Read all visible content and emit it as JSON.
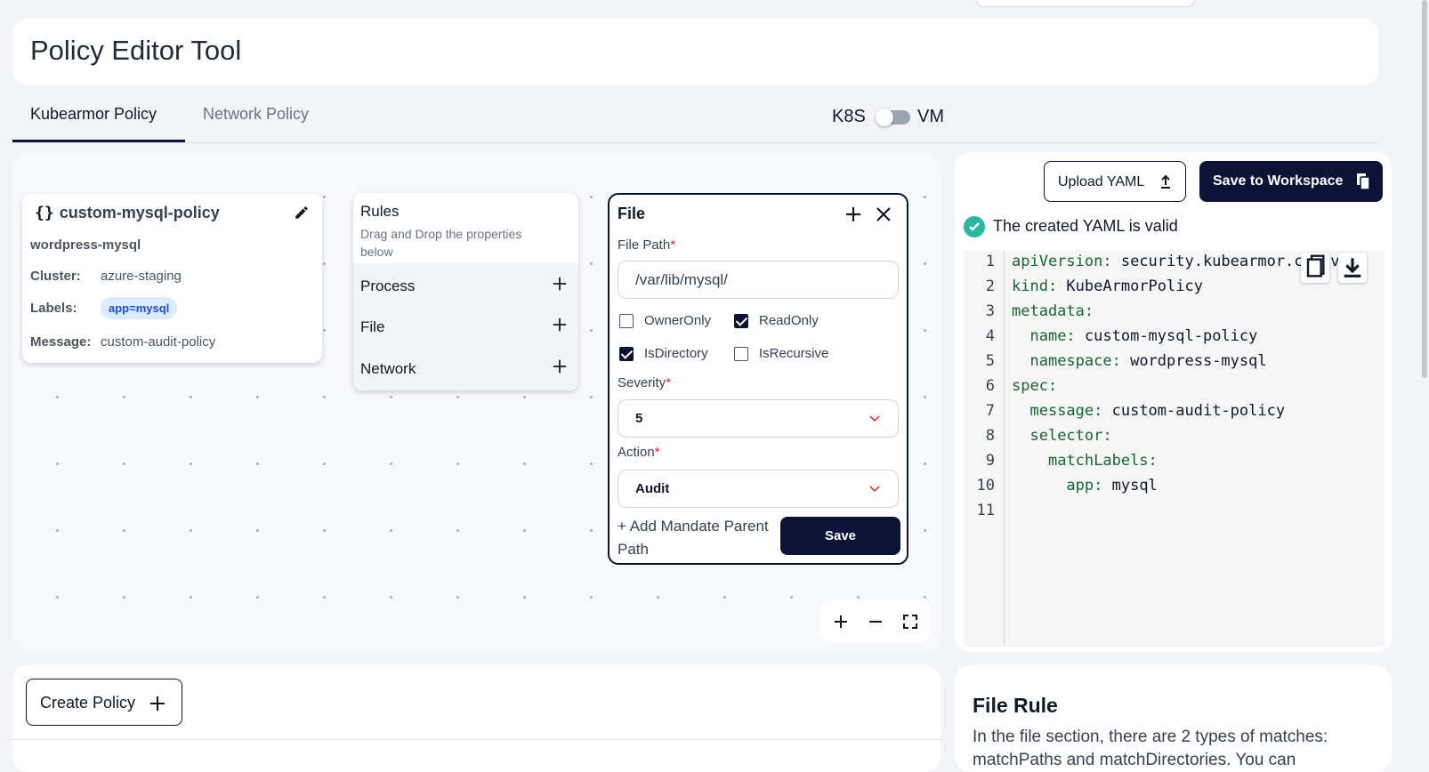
{
  "page": {
    "title": "Policy Editor Tool"
  },
  "tabs": [
    {
      "label": "Kubearmor Policy",
      "active": true
    },
    {
      "label": "Network Policy",
      "active": false
    }
  ],
  "env_toggle": {
    "left": "K8S",
    "right": "VM",
    "selected": "K8S"
  },
  "policy_node": {
    "name": "custom-mysql-policy",
    "namespace": "wordpress-mysql",
    "cluster_label": "Cluster:",
    "cluster": "azure-staging",
    "labels_label": "Labels:",
    "label_badge": "app=mysql",
    "message_label": "Message:",
    "message": "custom-audit-policy"
  },
  "rules_node": {
    "title": "Rules",
    "subtitle": "Drag and Drop the properties below",
    "items": [
      "Process",
      "File",
      "Network"
    ]
  },
  "file_node": {
    "title": "File",
    "file_path_label": "File Path",
    "file_path": "/var/lib/mysql/",
    "checkboxes": [
      {
        "label": "OwnerOnly",
        "checked": false
      },
      {
        "label": "ReadOnly",
        "checked": true
      },
      {
        "label": "IsDirectory",
        "checked": true
      },
      {
        "label": "IsRecursive",
        "checked": false
      }
    ],
    "severity_label": "Severity",
    "severity": "5",
    "action_label": "Action",
    "action": "Audit",
    "add_parent": "+ Add Mandate Parent Path",
    "save": "Save"
  },
  "right_panel": {
    "upload_label": "Upload YAML",
    "workspace_label": "Save to Workspace",
    "valid_text": "The created YAML is valid",
    "yaml_lines": [
      {
        "n": "1",
        "indent": "",
        "key": "apiVersion:",
        "val": " security.kubearmor.com/v1"
      },
      {
        "n": "2",
        "indent": "",
        "key": "kind:",
        "val": " KubeArmorPolicy"
      },
      {
        "n": "3",
        "indent": "",
        "key": "metadata:",
        "val": ""
      },
      {
        "n": "4",
        "indent": "  ",
        "key": "name:",
        "val": " custom-mysql-policy"
      },
      {
        "n": "5",
        "indent": "  ",
        "key": "namespace:",
        "val": " wordpress-mysql"
      },
      {
        "n": "6",
        "indent": "",
        "key": "spec:",
        "val": ""
      },
      {
        "n": "7",
        "indent": "  ",
        "key": "message:",
        "val": " custom-audit-policy"
      },
      {
        "n": "8",
        "indent": "  ",
        "key": "selector:",
        "val": ""
      },
      {
        "n": "9",
        "indent": "    ",
        "key": "matchLabels:",
        "val": ""
      },
      {
        "n": "10",
        "indent": "      ",
        "key": "app:",
        "val": " mysql"
      },
      {
        "n": "11",
        "indent": "",
        "key": "",
        "val": ""
      }
    ]
  },
  "bottom": {
    "create_label": "Create Policy",
    "file_rule_title": "File Rule",
    "file_rule_desc": "In the file section, there are 2 types of matches: matchPaths and matchDirectories. You can"
  },
  "colors": {
    "primary": "#0b1437",
    "valid": "#2cb5a0",
    "badge_bg": "#dbeafe",
    "badge_text": "#1d4ed8"
  },
  "icons": [
    "edit-icon",
    "plus-icon",
    "close-icon",
    "chevron-down-icon",
    "upload-icon",
    "copy-icon",
    "download-icon",
    "check-circle-icon",
    "minus-icon",
    "fullscreen-icon"
  ]
}
